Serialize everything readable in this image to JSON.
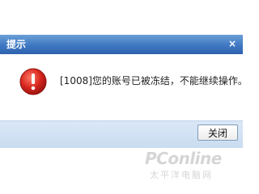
{
  "dialog": {
    "title": "提示",
    "close_glyph": "×",
    "message": "[1008]您的账号已被冻结，不能继续操作。",
    "icon": "error-exclamation-icon",
    "button_label": "关闭"
  },
  "watermark": {
    "main": "PConline",
    "sub": "太平洋电脑网"
  },
  "colors": {
    "title_bar": "#3f78c2",
    "footer": "#d4e3f5",
    "error_red": "#d7261e"
  }
}
